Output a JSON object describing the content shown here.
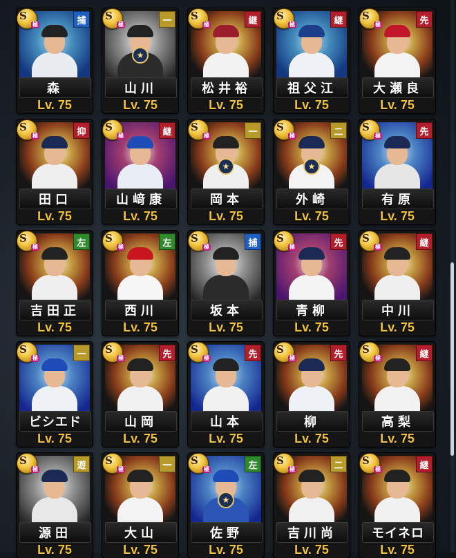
{
  "colors": {
    "position_catcher": "#1f5fc2",
    "position_infield": "#b79a2a",
    "position_reliever": "#b21f2a",
    "position_starter": "#b21f2a",
    "position_outfield": "#2f8a2c",
    "level_text": "#f3c33a"
  },
  "cards": [
    {
      "name": "森",
      "position": "捕",
      "position_type": "catcher",
      "level": "Lv. 75",
      "rank": "S",
      "badge": "極",
      "bg": "bg-blue-tex",
      "cap": "#222",
      "uniform": "#e9edf2",
      "emblem": false
    },
    {
      "name": "山川",
      "position": "一",
      "position_type": "infield",
      "level": "Lv. 75",
      "rank": "S",
      "badge": "極",
      "bg": "bg-mono",
      "cap": "#222",
      "uniform": "#2b2b2b",
      "emblem": true
    },
    {
      "name": "松井裕",
      "position": "継",
      "position_type": "reliever",
      "level": "Lv. 75",
      "rank": "S",
      "badge": "極",
      "bg": "",
      "cap": "#9b1c2a",
      "uniform": "#f2f2f2",
      "emblem": false
    },
    {
      "name": "祖父江",
      "position": "継",
      "position_type": "reliever",
      "level": "Lv. 75",
      "rank": "S",
      "badge": "極",
      "bg": "bg-blue-tex",
      "cap": "#1c3d8a",
      "uniform": "#eef2f7",
      "emblem": false
    },
    {
      "name": "大瀬良",
      "position": "先",
      "position_type": "starter",
      "level": "Lv. 75",
      "rank": "S",
      "badge": "極",
      "bg": "",
      "cap": "#c2162a",
      "uniform": "#f4f4f4",
      "emblem": false
    },
    {
      "name": "田口",
      "position": "抑",
      "position_type": "reliever",
      "level": "Lv. 75",
      "rank": "S",
      "badge": "極",
      "bg": "",
      "cap": "#1a2a55",
      "uniform": "#f0f0f0",
      "emblem": false
    },
    {
      "name": "山﨑康",
      "position": "継",
      "position_type": "reliever",
      "level": "Lv. 75",
      "rank": "S",
      "badge": "極",
      "bg": "bg-purple",
      "cap": "#1f4db8",
      "uniform": "#e9eef5",
      "emblem": false
    },
    {
      "name": "岡本",
      "position": "一",
      "position_type": "infield",
      "level": "Lv. 75",
      "rank": "S",
      "badge": "極",
      "bg": "",
      "cap": "#222",
      "uniform": "#f0f0f0",
      "emblem": true
    },
    {
      "name": "外崎",
      "position": "二",
      "position_type": "infield",
      "level": "Lv. 75",
      "rank": "S",
      "badge": "極",
      "bg": "",
      "cap": "#1a2a55",
      "uniform": "#f3f3f3",
      "emblem": true
    },
    {
      "name": "有原",
      "position": "先",
      "position_type": "starter",
      "level": "Lv. 75",
      "rank": "S",
      "badge": "極",
      "bg": "bg-blue-star",
      "cap": "#1a2a55",
      "uniform": "#e6e6e6",
      "emblem": false
    },
    {
      "name": "吉田正",
      "position": "左",
      "position_type": "outfield",
      "level": "Lv. 75",
      "rank": "S",
      "badge": "極",
      "bg": "",
      "cap": "#222",
      "uniform": "#efefef",
      "emblem": false
    },
    {
      "name": "西川",
      "position": "左",
      "position_type": "outfield",
      "level": "Lv. 75",
      "rank": "S",
      "badge": "極",
      "bg": "",
      "cap": "#c8161f",
      "uniform": "#f6f6f6",
      "emblem": false
    },
    {
      "name": "坂本",
      "position": "捕",
      "position_type": "catcher",
      "level": "Lv. 75",
      "rank": "S",
      "badge": "極",
      "bg": "bg-mono",
      "cap": "#222",
      "uniform": "#2a2a2a",
      "emblem": false
    },
    {
      "name": "青柳",
      "position": "先",
      "position_type": "starter",
      "level": "Lv. 75",
      "rank": "S",
      "badge": "極",
      "bg": "bg-purple",
      "cap": "#1a2a55",
      "uniform": "#f3f3f3",
      "emblem": false
    },
    {
      "name": "中川",
      "position": "継",
      "position_type": "reliever",
      "level": "Lv. 75",
      "rank": "S",
      "badge": "極",
      "bg": "",
      "cap": "#222",
      "uniform": "#efefef",
      "emblem": false
    },
    {
      "name": "ビシエド",
      "position": "一",
      "position_type": "infield",
      "level": "Lv. 75",
      "rank": "S",
      "badge": "極",
      "bg": "bg-blue-star",
      "cap": "#1f4db8",
      "uniform": "#eef2f7",
      "emblem": false
    },
    {
      "name": "山岡",
      "position": "先",
      "position_type": "starter",
      "level": "Lv. 75",
      "rank": "S",
      "badge": "極",
      "bg": "",
      "cap": "#222",
      "uniform": "#f1f1f1",
      "emblem": false
    },
    {
      "name": "山本",
      "position": "先",
      "position_type": "starter",
      "level": "Lv. 75",
      "rank": "S",
      "badge": "極",
      "bg": "bg-blue-star",
      "cap": "#222",
      "uniform": "#f1f1f1",
      "emblem": false
    },
    {
      "name": "柳",
      "position": "先",
      "position_type": "starter",
      "level": "Lv. 75",
      "rank": "S",
      "badge": "極",
      "bg": "",
      "cap": "#1a2a55",
      "uniform": "#eef2f7",
      "emblem": false
    },
    {
      "name": "高梨",
      "position": "継",
      "position_type": "reliever",
      "level": "Lv. 75",
      "rank": "S",
      "badge": "極",
      "bg": "",
      "cap": "#222",
      "uniform": "#f2f2f2",
      "emblem": false
    },
    {
      "name": "源田",
      "position": "遊",
      "position_type": "infield",
      "level": "Lv. 75",
      "rank": "S",
      "badge": "極",
      "bg": "bg-mono",
      "cap": "#1a2a55",
      "uniform": "#e8e8e8",
      "emblem": false
    },
    {
      "name": "大山",
      "position": "一",
      "position_type": "infield",
      "level": "Lv. 75",
      "rank": "S",
      "badge": "極",
      "bg": "",
      "cap": "#222",
      "uniform": "#f3f3f3",
      "emblem": false
    },
    {
      "name": "佐野",
      "position": "左",
      "position_type": "outfield",
      "level": "Lv. 75",
      "rank": "S",
      "badge": "極",
      "bg": "bg-blue-star",
      "cap": "#1f4db8",
      "uniform": "#2b56b5",
      "emblem": true
    },
    {
      "name": "吉川尚",
      "position": "二",
      "position_type": "infield",
      "level": "Lv. 75",
      "rank": "S",
      "badge": "極",
      "bg": "",
      "cap": "#222",
      "uniform": "#f1f1f1",
      "emblem": false
    },
    {
      "name": "モイネロ",
      "position": "継",
      "position_type": "reliever",
      "level": "Lv. 75",
      "rank": "S",
      "badge": "極",
      "bg": "",
      "cap": "#222",
      "uniform": "#f1f1f1",
      "emblem": false
    }
  ]
}
